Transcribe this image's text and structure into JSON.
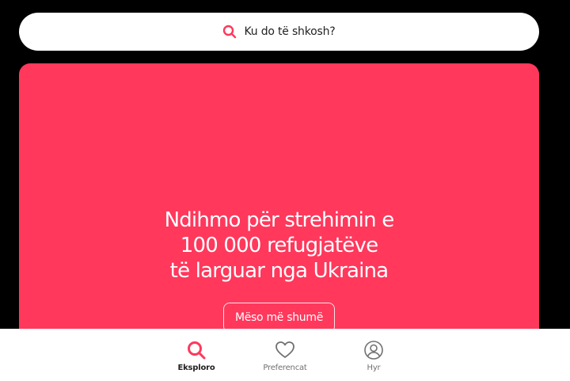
{
  "colors": {
    "brand": "#ff385c",
    "background": "#000000",
    "nav_active_text": "#222222",
    "nav_inactive": "#717171"
  },
  "search": {
    "placeholder_text": "Ku do të shkosh?",
    "icon": "search-icon"
  },
  "hero": {
    "title_lines": [
      "Ndihmo për strehimin e",
      "100 000 refugjatëve",
      "të larguar nga Ukraina"
    ],
    "button_label": "Mëso më shumë"
  },
  "bottom_nav": {
    "items": [
      {
        "label": "Eksploro",
        "icon": "search-icon",
        "active": true
      },
      {
        "label": "Preferencat",
        "icon": "heart-icon",
        "active": false
      },
      {
        "label": "Hyr",
        "icon": "user-circle-icon",
        "active": false
      }
    ]
  }
}
